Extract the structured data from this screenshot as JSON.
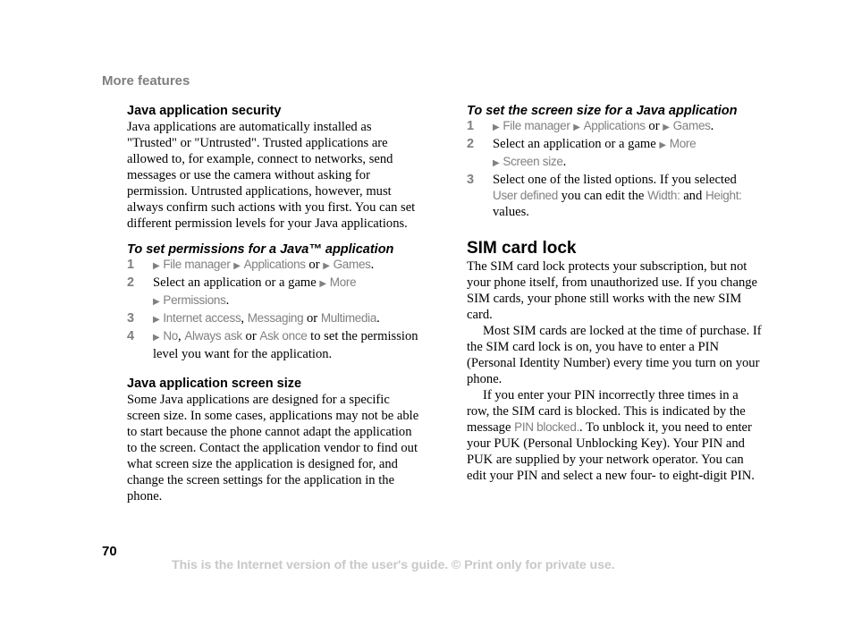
{
  "header": {
    "section": "More features"
  },
  "left": {
    "security": {
      "title": "Java application security",
      "body": "Java applications are automatically installed as \"Trusted\" or \"Untrusted\". Trusted applications are allowed to, for example, connect to networks, send messages or use the camera without asking for permission. Untrusted applications, however, must always confirm such actions with you first. You can set different permission levels for your Java applications."
    },
    "permissions": {
      "title": "To set permissions for a Java™ application",
      "steps": [
        {
          "num": "1",
          "parts": {
            "m1": "File manager",
            "m2": "Applications",
            "or": "or",
            "m3": "Games",
            "end": "."
          }
        },
        {
          "num": "2",
          "parts": {
            "t1": "Select an application or a game",
            "m1": "More",
            "m2": "Permissions",
            "end": "."
          }
        },
        {
          "num": "3",
          "parts": {
            "m1": "Internet access",
            "sep": ",",
            "m2": "Messaging",
            "or": "or",
            "m3": "Multimedia",
            "end": "."
          }
        },
        {
          "num": "4",
          "parts": {
            "m1": "No",
            "sep": ",",
            "m2": "Always ask",
            "or": "or",
            "m3": "Ask once",
            "t1": "to set the permission level you want for the application."
          }
        }
      ]
    },
    "screen_size": {
      "title": "Java application screen size",
      "body": "Some Java applications are designed for a specific screen size. In some cases, applications may not be able to start because the phone cannot adapt the application to the screen. Contact the application vendor to find out what screen size the application is designed for, and change the screen settings for the application in the phone."
    }
  },
  "right": {
    "set_screen": {
      "title": "To set the screen size for a Java application",
      "steps": [
        {
          "num": "1",
          "parts": {
            "m1": "File manager",
            "m2": "Applications",
            "or": "or",
            "m3": "Games",
            "end": "."
          }
        },
        {
          "num": "2",
          "parts": {
            "t1": "Select an application or a game",
            "m1": "More",
            "m2": "Screen size",
            "end": "."
          }
        },
        {
          "num": "3",
          "parts": {
            "t1": "Select one of the listed options. If you selected",
            "m1": "User defined",
            "t2": "you can edit the",
            "m2": "Width:",
            "t3": "and",
            "m3": "Height:",
            "t4": "values."
          }
        }
      ]
    },
    "sim_lock": {
      "title": "SIM card lock",
      "p1": "The SIM card lock protects your subscription, but not your phone itself, from unauthorized use. If you change SIM cards, your phone still works with the new SIM card.",
      "p2": "Most SIM cards are locked at the time of purchase. If the SIM card lock is on, you have to enter a PIN (Personal Identity Number) every time you turn on your phone.",
      "p3_a": "If you enter your PIN incorrectly three times in a row, the SIM card is blocked. This is indicated by the message",
      "p3_menu": "PIN blocked.",
      "p3_b": ". To unblock it, you need to enter your PUK (Personal Unblocking Key). Your PIN and PUK are supplied by your network operator. You can edit your PIN and select a new four- to eight-digit PIN."
    }
  },
  "footer": {
    "page_number": "70",
    "notice": "This is the Internet version of the user's guide. © Print only for private use."
  },
  "icons": {
    "arrow": "▶"
  },
  "colors": {
    "menu_grey": "#808080",
    "header_grey": "#7f7f7f",
    "footer_grey": "#c8c8c8"
  }
}
